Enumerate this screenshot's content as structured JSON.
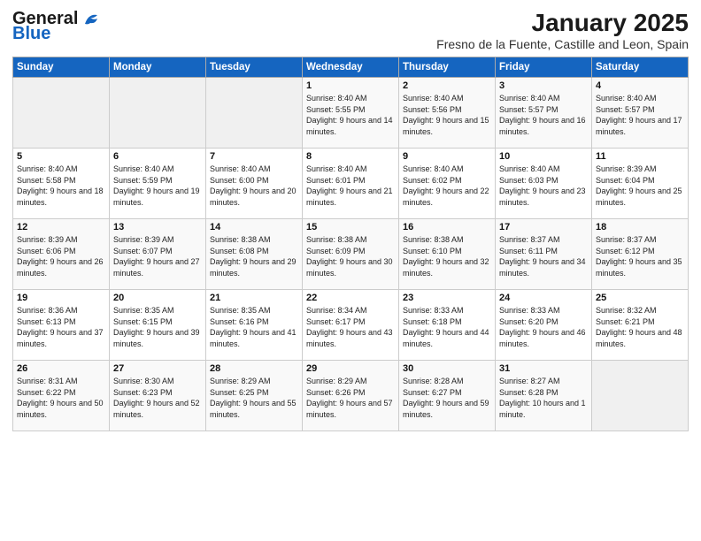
{
  "header": {
    "logo_line1": "General",
    "logo_line2": "Blue",
    "month": "January 2025",
    "location": "Fresno de la Fuente, Castille and Leon, Spain"
  },
  "weekdays": [
    "Sunday",
    "Monday",
    "Tuesday",
    "Wednesday",
    "Thursday",
    "Friday",
    "Saturday"
  ],
  "weeks": [
    [
      {
        "day": "",
        "empty": true
      },
      {
        "day": "",
        "empty": true
      },
      {
        "day": "",
        "empty": true
      },
      {
        "day": "1",
        "info": "Sunrise: 8:40 AM\nSunset: 5:55 PM\nDaylight: 9 hours and 14 minutes."
      },
      {
        "day": "2",
        "info": "Sunrise: 8:40 AM\nSunset: 5:56 PM\nDaylight: 9 hours and 15 minutes."
      },
      {
        "day": "3",
        "info": "Sunrise: 8:40 AM\nSunset: 5:57 PM\nDaylight: 9 hours and 16 minutes."
      },
      {
        "day": "4",
        "info": "Sunrise: 8:40 AM\nSunset: 5:57 PM\nDaylight: 9 hours and 17 minutes."
      }
    ],
    [
      {
        "day": "5",
        "info": "Sunrise: 8:40 AM\nSunset: 5:58 PM\nDaylight: 9 hours and 18 minutes."
      },
      {
        "day": "6",
        "info": "Sunrise: 8:40 AM\nSunset: 5:59 PM\nDaylight: 9 hours and 19 minutes."
      },
      {
        "day": "7",
        "info": "Sunrise: 8:40 AM\nSunset: 6:00 PM\nDaylight: 9 hours and 20 minutes."
      },
      {
        "day": "8",
        "info": "Sunrise: 8:40 AM\nSunset: 6:01 PM\nDaylight: 9 hours and 21 minutes."
      },
      {
        "day": "9",
        "info": "Sunrise: 8:40 AM\nSunset: 6:02 PM\nDaylight: 9 hours and 22 minutes."
      },
      {
        "day": "10",
        "info": "Sunrise: 8:40 AM\nSunset: 6:03 PM\nDaylight: 9 hours and 23 minutes."
      },
      {
        "day": "11",
        "info": "Sunrise: 8:39 AM\nSunset: 6:04 PM\nDaylight: 9 hours and 25 minutes."
      }
    ],
    [
      {
        "day": "12",
        "info": "Sunrise: 8:39 AM\nSunset: 6:06 PM\nDaylight: 9 hours and 26 minutes."
      },
      {
        "day": "13",
        "info": "Sunrise: 8:39 AM\nSunset: 6:07 PM\nDaylight: 9 hours and 27 minutes."
      },
      {
        "day": "14",
        "info": "Sunrise: 8:38 AM\nSunset: 6:08 PM\nDaylight: 9 hours and 29 minutes."
      },
      {
        "day": "15",
        "info": "Sunrise: 8:38 AM\nSunset: 6:09 PM\nDaylight: 9 hours and 30 minutes."
      },
      {
        "day": "16",
        "info": "Sunrise: 8:38 AM\nSunset: 6:10 PM\nDaylight: 9 hours and 32 minutes."
      },
      {
        "day": "17",
        "info": "Sunrise: 8:37 AM\nSunset: 6:11 PM\nDaylight: 9 hours and 34 minutes."
      },
      {
        "day": "18",
        "info": "Sunrise: 8:37 AM\nSunset: 6:12 PM\nDaylight: 9 hours and 35 minutes."
      }
    ],
    [
      {
        "day": "19",
        "info": "Sunrise: 8:36 AM\nSunset: 6:13 PM\nDaylight: 9 hours and 37 minutes."
      },
      {
        "day": "20",
        "info": "Sunrise: 8:35 AM\nSunset: 6:15 PM\nDaylight: 9 hours and 39 minutes."
      },
      {
        "day": "21",
        "info": "Sunrise: 8:35 AM\nSunset: 6:16 PM\nDaylight: 9 hours and 41 minutes."
      },
      {
        "day": "22",
        "info": "Sunrise: 8:34 AM\nSunset: 6:17 PM\nDaylight: 9 hours and 43 minutes."
      },
      {
        "day": "23",
        "info": "Sunrise: 8:33 AM\nSunset: 6:18 PM\nDaylight: 9 hours and 44 minutes."
      },
      {
        "day": "24",
        "info": "Sunrise: 8:33 AM\nSunset: 6:20 PM\nDaylight: 9 hours and 46 minutes."
      },
      {
        "day": "25",
        "info": "Sunrise: 8:32 AM\nSunset: 6:21 PM\nDaylight: 9 hours and 48 minutes."
      }
    ],
    [
      {
        "day": "26",
        "info": "Sunrise: 8:31 AM\nSunset: 6:22 PM\nDaylight: 9 hours and 50 minutes."
      },
      {
        "day": "27",
        "info": "Sunrise: 8:30 AM\nSunset: 6:23 PM\nDaylight: 9 hours and 52 minutes."
      },
      {
        "day": "28",
        "info": "Sunrise: 8:29 AM\nSunset: 6:25 PM\nDaylight: 9 hours and 55 minutes."
      },
      {
        "day": "29",
        "info": "Sunrise: 8:29 AM\nSunset: 6:26 PM\nDaylight: 9 hours and 57 minutes."
      },
      {
        "day": "30",
        "info": "Sunrise: 8:28 AM\nSunset: 6:27 PM\nDaylight: 9 hours and 59 minutes."
      },
      {
        "day": "31",
        "info": "Sunrise: 8:27 AM\nSunset: 6:28 PM\nDaylight: 10 hours and 1 minute."
      },
      {
        "day": "",
        "empty": true
      }
    ]
  ]
}
